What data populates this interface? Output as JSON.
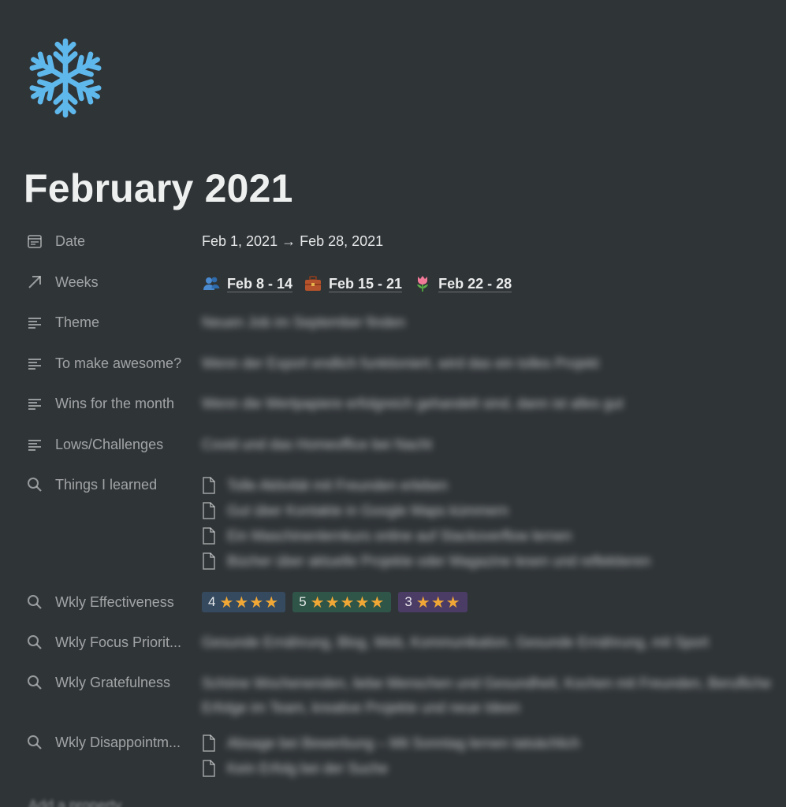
{
  "page": {
    "icon": "snowflake-icon",
    "title": "February 2021",
    "accent_icon_color": "#5fb8ec"
  },
  "properties": {
    "date": {
      "label": "Date",
      "value": "Feb 1, 2021 → Feb 28, 2021"
    },
    "weeks": {
      "label": "Weeks",
      "items": [
        {
          "emoji": "people-icon",
          "text": "Feb 8 - 14"
        },
        {
          "emoji": "briefcase-icon",
          "text": "Feb 15 - 21"
        },
        {
          "emoji": "tulip-icon",
          "text": "Feb 22 - 28"
        }
      ]
    },
    "theme": {
      "label": "Theme",
      "value": "Neuen Job im September finden"
    },
    "to_make_awesome": {
      "label": "To make awesome?",
      "value": "Wenn der Export endlich funktioniert, wird das ein tolles Projekt"
    },
    "wins": {
      "label": "Wins for the month",
      "value": "Wenn die Wertpapiere erfolgreich gehandelt sind, dann ist alles gut"
    },
    "lows": {
      "label": "Lows/Challenges",
      "value": "Covid und das Homeoffice bei Nacht"
    },
    "things_learned": {
      "label": "Things I learned",
      "items": [
        "Tolle Aktivität mit Freunden erleben",
        "Gut über Kontakte in Google Maps kümmern",
        "Ein Maschinenlernkurs online auf Stackoverflow lernen",
        "Bücher über aktuelle Projekte oder Magazine lesen und reflektieren"
      ]
    },
    "wkly_effectiveness": {
      "label": "Wkly Effectiveness",
      "tags": [
        {
          "num": "4",
          "stars": "★★★★",
          "color": "blue"
        },
        {
          "num": "5",
          "stars": "★★★★★",
          "color": "green"
        },
        {
          "num": "3",
          "stars": "★★★",
          "color": "purple"
        }
      ]
    },
    "wkly_focus": {
      "label": "Wkly Focus Priorit...",
      "value": "Gesunde Ernährung, Blog, Web, Kommunikation, Gesunde Ernährung, mit Sport"
    },
    "wkly_gratefulness": {
      "label": "Wkly Gratefulness",
      "value": "Schöne Wochenenden, liebe Menschen und Gesundheit, Kochen mit Freunden, Berufliche Erfolge im Team, kreative Projekte und neue Ideen"
    },
    "wkly_disappointments": {
      "label": "Wkly Disappointm...",
      "items": [
        "Absage bei Bewerbung – Mit Sonntag lernen tatsächlich",
        "Kein Erfolg bei der Suche"
      ]
    }
  },
  "footer": {
    "add_property": "Add a property"
  }
}
